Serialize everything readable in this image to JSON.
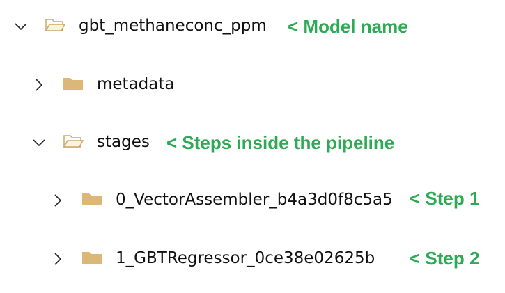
{
  "tree": {
    "root": {
      "label": "gbt_methaneconc_ppm",
      "expanded": true,
      "icon": "folder-open-icon",
      "annotation": "< Model name"
    },
    "metadata": {
      "label": "metadata",
      "expanded": false,
      "icon": "folder-closed-icon"
    },
    "stages": {
      "label": "stages",
      "expanded": true,
      "icon": "folder-open-icon",
      "annotation": "< Steps inside the pipeline"
    },
    "step1": {
      "label": "0_VectorAssembler_b4a3d0f8c5a5",
      "expanded": false,
      "icon": "folder-closed-icon",
      "annotation": "< Step 1"
    },
    "step2": {
      "label": "1_GBTRegressor_0ce38e02625b",
      "expanded": false,
      "icon": "folder-closed-icon",
      "annotation": "< Step 2"
    }
  },
  "colors": {
    "annotation": "#2eaa55",
    "folder": "#dcb778",
    "text": "#111111"
  }
}
